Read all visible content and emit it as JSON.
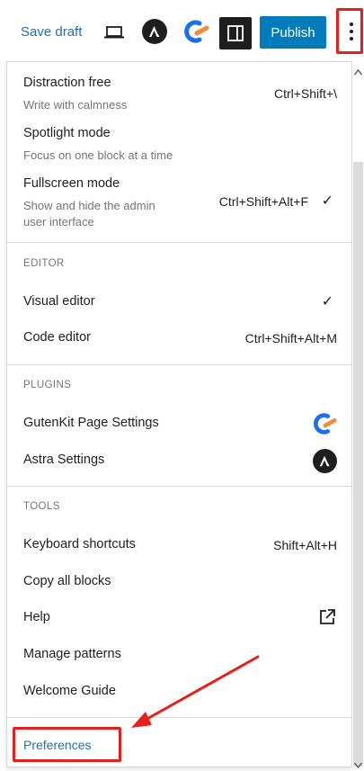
{
  "toolbar": {
    "save_draft": "Save draft",
    "publish": "Publish",
    "icons": [
      "device-preview-icon",
      "astra-icon",
      "gutenkit-icon",
      "settings-sidebar-icon",
      "more-options-icon"
    ]
  },
  "menu": {
    "view": [
      {
        "label": "Distraction free",
        "desc": "Write with calmness",
        "shortcut": "Ctrl+Shift+\\"
      },
      {
        "label": "Spotlight mode",
        "desc": "Focus on one block at a time",
        "shortcut": ""
      },
      {
        "label": "Fullscreen mode",
        "desc": "Show and hide the admin",
        "desc2": "user interface",
        "shortcut": "Ctrl+Shift+Alt+F",
        "checked": true
      }
    ],
    "editor": {
      "heading": "EDITOR",
      "items": [
        {
          "label": "Visual editor",
          "checked": true
        },
        {
          "label": "Code editor",
          "shortcut": "Ctrl+Shift+Alt+M"
        }
      ]
    },
    "plugins": {
      "heading": "PLUGINS",
      "items": [
        {
          "label": "GutenKit Page Settings",
          "icon": "gutenkit-icon"
        },
        {
          "label": "Astra Settings",
          "icon": "astra-icon"
        }
      ]
    },
    "tools": {
      "heading": "TOOLS",
      "items": [
        {
          "label": "Keyboard shortcuts",
          "shortcut": "Shift+Alt+H"
        },
        {
          "label": "Copy all blocks"
        },
        {
          "label": "Help",
          "icon": "external-link-icon"
        },
        {
          "label": "Manage patterns"
        },
        {
          "label": "Welcome Guide"
        }
      ]
    },
    "preferences": "Preferences",
    "check_glyph": "✓"
  },
  "colors": {
    "accent": "#007cba",
    "link": "#2271b1",
    "highlight": "#e62018",
    "gutenkit_blue": "#1a6ff0",
    "gutenkit_orange": "#f5883b"
  }
}
